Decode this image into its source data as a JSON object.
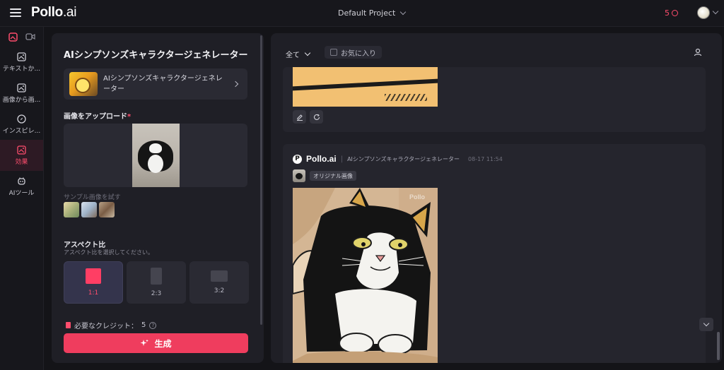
{
  "topbar": {
    "logo_main": "Pollo",
    "logo_suffix": ".ai",
    "project": "Default Project",
    "credits": "5"
  },
  "sidebar": {
    "items": [
      {
        "label": "テキストか...",
        "icon": "text-to-image-icon"
      },
      {
        "label": "画像から画...",
        "icon": "image-to-image-icon"
      },
      {
        "label": "インスピレ...",
        "icon": "compass-icon"
      },
      {
        "label": "効果",
        "icon": "effects-icon",
        "active": true
      },
      {
        "label": "AIツール",
        "icon": "ai-tools-icon"
      }
    ]
  },
  "panel": {
    "title": "AIシンプソンズキャラクタージェネレーター",
    "model_name": "AIシンプソンズキャラクタージェネレーター",
    "upload_label": "画像をアップロード",
    "required_mark": "*",
    "sample_label": "サンプル画像を試す",
    "aspect_label": "アスペクト比",
    "aspect_sub": "アスペクト比を選択してください。",
    "aspects": [
      {
        "value": "1:1",
        "selected": true
      },
      {
        "value": "2:3",
        "selected": false
      },
      {
        "value": "3:2",
        "selected": false
      }
    ],
    "credit_label": "必要なクレジット：",
    "credit_value": "5",
    "help_glyph": "?",
    "generate_label": "生成"
  },
  "feed": {
    "filter_label": "全て",
    "favorite_label": "お気に入り",
    "card2": {
      "brand": "Pollo.ai",
      "separator": "|",
      "model": "AIシンプソンズキャラクタージェネレーター",
      "time": "08-17 11:54",
      "original_badge": "オリジナル画像",
      "watermark": "Pollo"
    }
  },
  "colors": {
    "accent": "#ef3d5e",
    "active_text": "#ff4d6d",
    "background": "#141418",
    "panel": "#1f1f26"
  }
}
